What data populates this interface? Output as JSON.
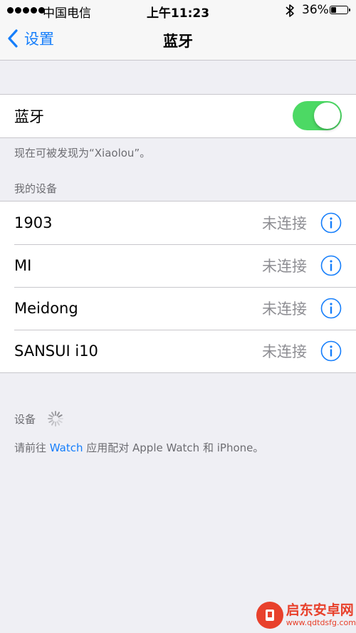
{
  "status_bar": {
    "carrier": "中国电信",
    "time": "上午11:23",
    "battery_percent": "36%",
    "battery_level": 0.36,
    "signal_bars": 5
  },
  "nav": {
    "back_label": "设置",
    "title": "蓝牙"
  },
  "bluetooth": {
    "label": "蓝牙",
    "enabled": true,
    "toggle_color": "#4cd964",
    "discoverable_note": "现在可被发现为“Xiaolou”。"
  },
  "my_devices": {
    "header": "我的设备",
    "items": [
      {
        "name": "1903",
        "status": "未连接"
      },
      {
        "name": "MI",
        "status": "未连接"
      },
      {
        "name": "Meidong",
        "status": "未连接"
      },
      {
        "name": "SANSUI i10",
        "status": "未连接"
      }
    ]
  },
  "other_devices": {
    "header": "设备",
    "note_prefix": "请前往 ",
    "note_link": "Watch",
    "note_suffix": " 应用配对 Apple Watch 和 iPhone。"
  },
  "watermark": {
    "name": "启东安卓网",
    "url": "www.qdtdsfg.com"
  },
  "colors": {
    "accent": "#157efb",
    "background": "#efeff4",
    "secondary_text": "#8e8e93"
  },
  "icons": {
    "back": "chevron-left-icon",
    "info": "info-circle-icon",
    "loading": "spinner-icon",
    "bluetooth": "bluetooth-icon"
  }
}
